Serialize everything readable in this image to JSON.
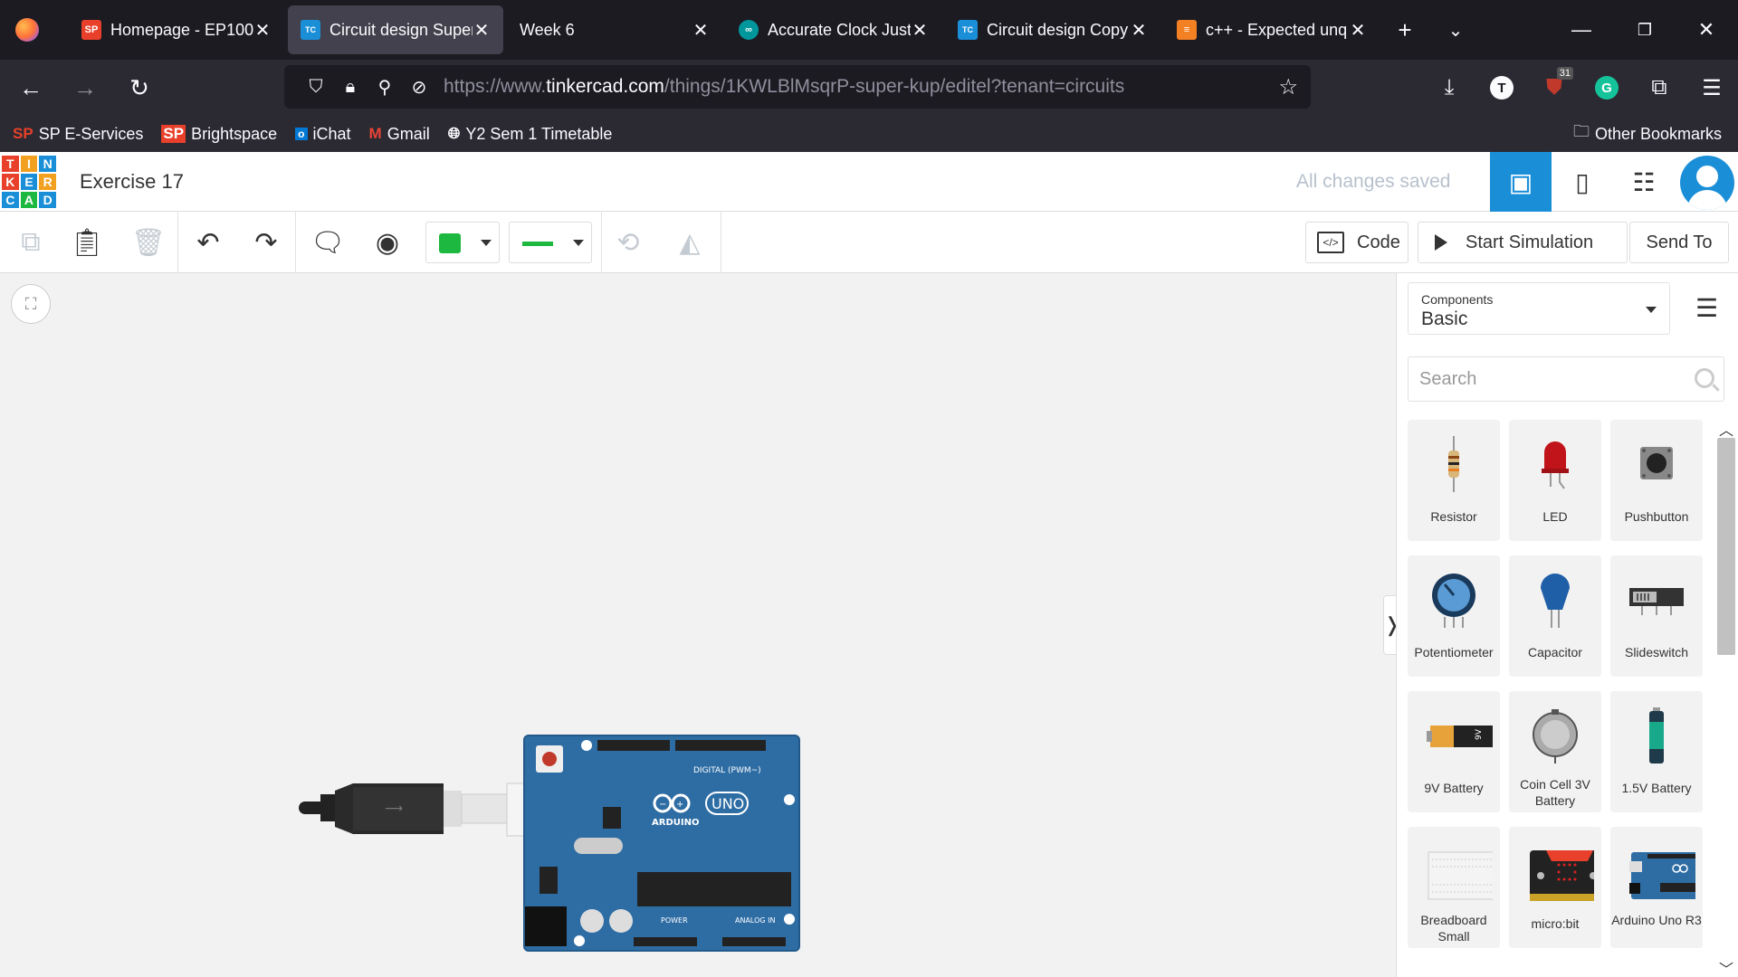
{
  "browser": {
    "tabs": [
      {
        "title": "Homepage - EP100(",
        "favicon": "SP",
        "active": false
      },
      {
        "title": "Circuit design Super",
        "favicon": "TC",
        "active": true
      },
      {
        "title": "Week 6",
        "favicon": "",
        "active": false
      },
      {
        "title": "Accurate Clock Just",
        "favicon": "∞",
        "active": false
      },
      {
        "title": "Circuit design Copy",
        "favicon": "TC",
        "active": false
      },
      {
        "title": "c++ - Expected unq",
        "favicon": "≡",
        "active": false
      }
    ],
    "url_prefix": "https://www.",
    "url_domain": "tinkercad.com",
    "url_path": "/things/1KWLBlMsqrP-super-kup/editel?tenant=circuits",
    "ext_badge": "31",
    "bookmarks": [
      {
        "label": "SP E-Services",
        "icon": "SP"
      },
      {
        "label": "Brightspace",
        "icon": "SP"
      },
      {
        "label": "iChat",
        "icon": "ichat-icon"
      },
      {
        "label": "Gmail",
        "icon": "M"
      },
      {
        "label": "Y2 Sem 1 Timetable",
        "icon": "globe-icon"
      }
    ],
    "other_bookmarks": "Other Bookmarks"
  },
  "app": {
    "logo_letters": [
      "T",
      "I",
      "N",
      "K",
      "E",
      "R",
      "C",
      "A",
      "D"
    ],
    "title": "Exercise 17",
    "save_status": "All changes saved",
    "toolbar": {
      "code_label": "Code",
      "start_sim_label": "Start Simulation",
      "send_to_label": "Send To",
      "selected_color": "#1db83f"
    },
    "panel": {
      "components_label": "Components",
      "components_value": "Basic",
      "search_placeholder": "Search",
      "items": [
        {
          "label": "Resistor"
        },
        {
          "label": "LED"
        },
        {
          "label": "Pushbutton"
        },
        {
          "label": "Potentiometer"
        },
        {
          "label": "Capacitor"
        },
        {
          "label": "Slideswitch"
        },
        {
          "label": "9V Battery"
        },
        {
          "label": "Coin Cell 3V Battery"
        },
        {
          "label": "1.5V Battery"
        },
        {
          "label": "Breadboard Small"
        },
        {
          "label": "micro:bit"
        },
        {
          "label": "Arduino Uno R3"
        }
      ]
    },
    "board": {
      "brand": "ARDUINO",
      "model": "UNO",
      "digital_label": "DIGITAL (PWM~)",
      "power_label": "POWER",
      "analog_label": "ANALOG IN",
      "battery_label": "9V"
    }
  },
  "colors": {
    "tinkercad_blue": "#1a8fd8",
    "board_blue": "#2e6da4",
    "logo": [
      "#e8402a",
      "#f2a020",
      "#1a8fd8",
      "#e8402a",
      "#1a8fd8",
      "#f2a020",
      "#1a8fd8",
      "#1db83f",
      "#1a8fd8"
    ]
  }
}
